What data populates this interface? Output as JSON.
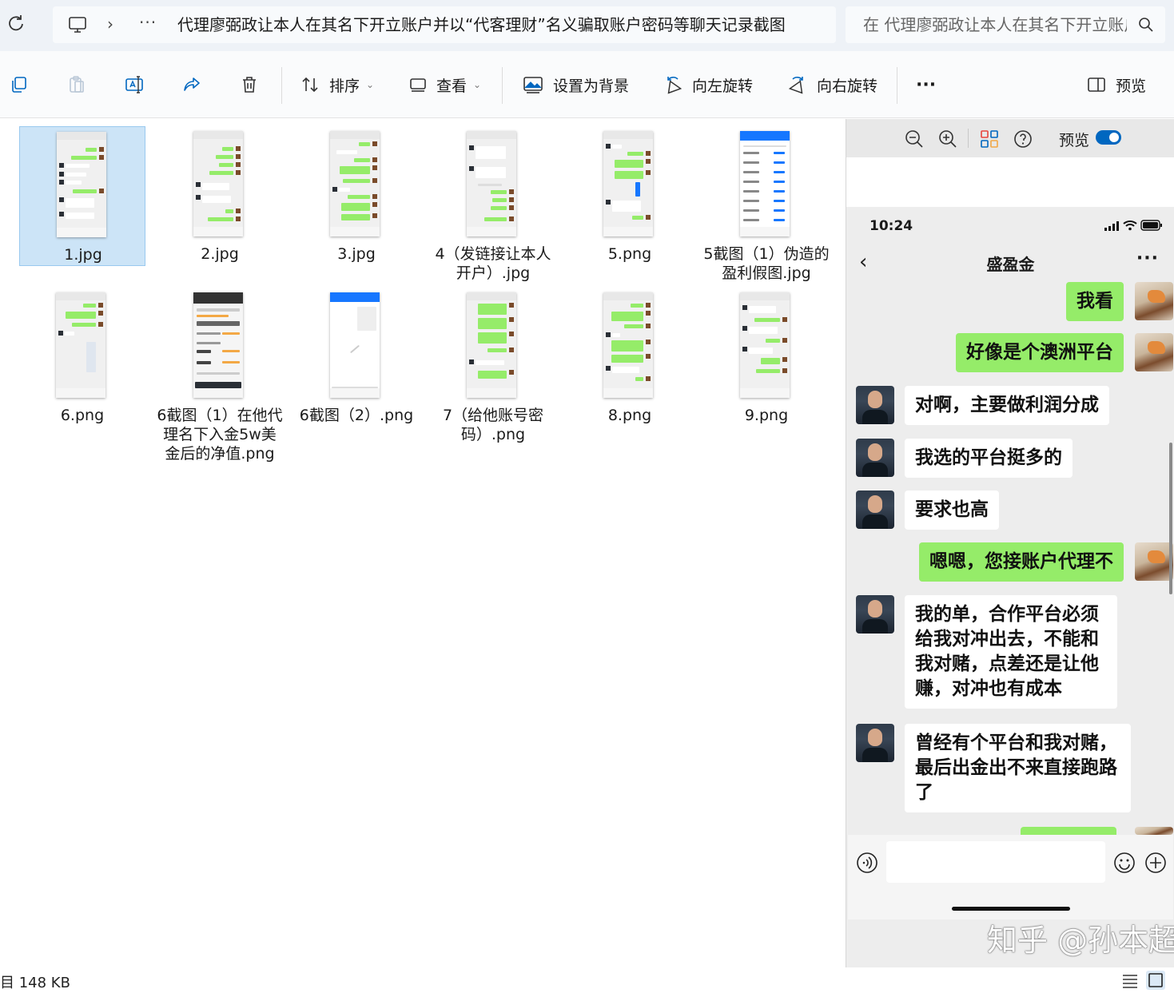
{
  "address_bar": {
    "path_text": "代理廖弼政让本人在其名下开立账户并以“代客理财”名义骗取账户密码等聊天记录截图",
    "search_placeholder": "在 代理廖弼政让本人在其名下开立账户并以“代客理财”名义骗取账户密码等聊天记录截图 中搜索",
    "ellipsis": "···"
  },
  "toolbar": {
    "sort_label": "排序",
    "view_label": "查看",
    "set_bg_label": "设置为背景",
    "rotate_left_label": "向左旋转",
    "rotate_right_label": "向右旋转",
    "more_label": "···",
    "preview_label": "预览"
  },
  "files": [
    {
      "name": "1.jpg",
      "selected": true
    },
    {
      "name": "2.jpg"
    },
    {
      "name": "3.jpg"
    },
    {
      "name": "4（发链接让本人开户）.jpg"
    },
    {
      "name": "5.png"
    },
    {
      "name": "5截图（1）伪造的盈利假图.jpg"
    },
    {
      "name": "6.png"
    },
    {
      "name": "6截图（1）在他代理名下入金5w美金后的净值.png"
    },
    {
      "name": "6截图（2）.png"
    },
    {
      "name": "7（给他账号密码）.png"
    },
    {
      "name": "8.png"
    },
    {
      "name": "9.png"
    }
  ],
  "preview_pane": {
    "toggle_label": "预览",
    "toggle_on": true,
    "phone": {
      "time": "10:24",
      "chat_title": "盛盈金",
      "back": "‹",
      "more": "···",
      "messages": [
        {
          "from": "me",
          "text": "我看"
        },
        {
          "from": "me",
          "text": "好像是个澳洲平台"
        },
        {
          "from": "other",
          "text": "对啊，主要做利润分成"
        },
        {
          "from": "other",
          "text": "我选的平台挺多的"
        },
        {
          "from": "other",
          "text": "要求也高"
        },
        {
          "from": "me",
          "text": "嗯嗯，您接账户代理不"
        },
        {
          "from": "other",
          "text": "我的单，合作平台必须给我对冲出去，不能和我对赌，点差还是让他赚，对冲也有成本"
        },
        {
          "from": "other",
          "text": "曾经有个平台和我对赌，最后出金出不来直接跑路了"
        }
      ]
    },
    "watermark": "知乎 @孙本超"
  },
  "status_bar": {
    "text": "目 148 KB"
  },
  "colors": {
    "selected_tile": "#cce4f7",
    "wechat_green": "#95ec69",
    "accent_blue": "#0067c0"
  }
}
